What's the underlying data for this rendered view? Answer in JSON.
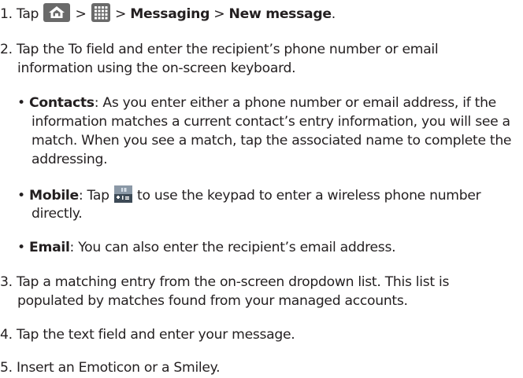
{
  "step1": {
    "num": "1. ",
    "tap": "Tap",
    "sep1": " > ",
    "sep2": " > ",
    "messaging": "Messaging",
    "sep3": " > ",
    "new_message": "New message",
    "end": ".",
    "home_icon": "home-icon",
    "apps_icon": "apps-grid-icon"
  },
  "step2": {
    "line1": "2. Tap the To field and enter the recipient’s phone number or email",
    "line2": "information using the on-screen keyboard."
  },
  "contacts": {
    "bullet": "• ",
    "label": "Contacts",
    "line1": ": As you enter either a phone number or email address, if the",
    "line2": "information matches a current contact’s entry information, you will see a",
    "line3": "match. When you see a match, tap the associated name to complete the",
    "line4": "addressing."
  },
  "mobile": {
    "bullet": "• ",
    "label": "Mobile",
    "text1": ": Tap ",
    "text2": " to use the keypad to enter a wireless phone number",
    "line2": "directly.",
    "keypad_icon": "keypad-icon"
  },
  "email": {
    "bullet": "• ",
    "label": "Email",
    "text": ": You can also enter the recipient’s email address."
  },
  "step3": {
    "line1": "3. Tap a matching entry from the on-screen dropdown list. This list is",
    "line2": "populated by matches found from your managed accounts."
  },
  "step4": {
    "line1": "4. Tap the text field and enter your message."
  },
  "step5": {
    "line1": "5. Insert an Emoticon or a Smiley."
  }
}
